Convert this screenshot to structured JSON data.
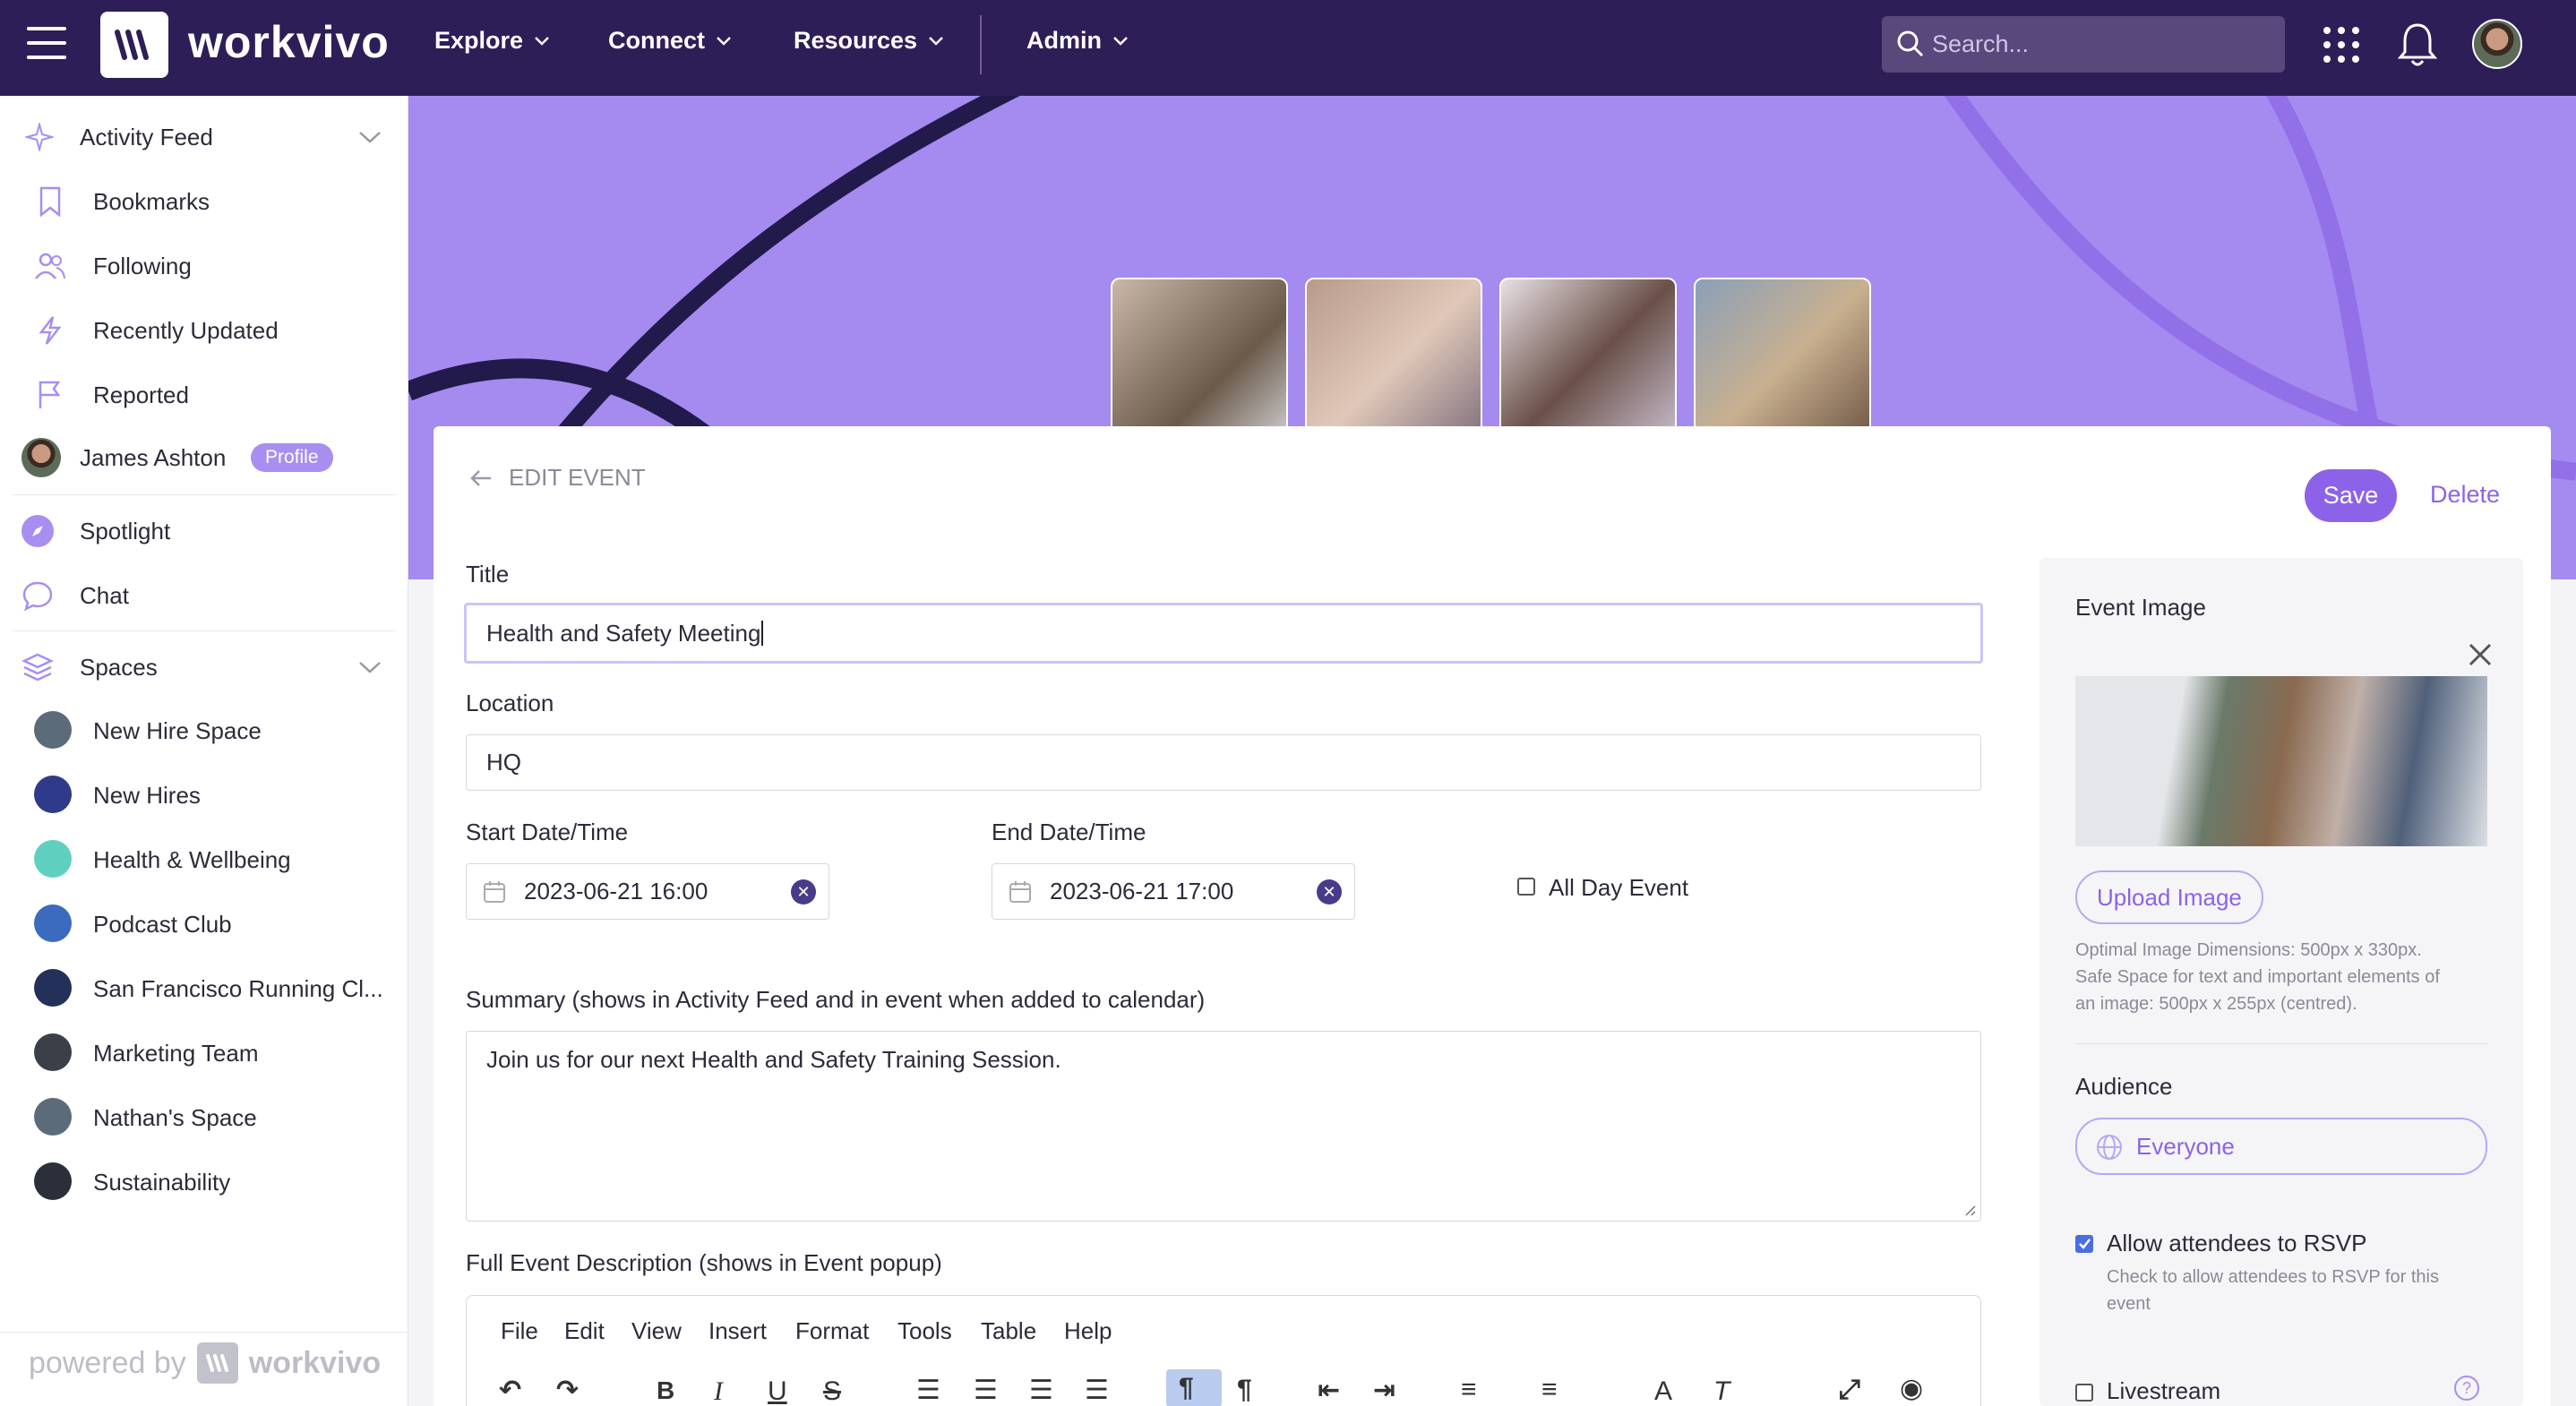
{
  "nav": {
    "brand": "workvivo",
    "items": [
      {
        "label": "Explore"
      },
      {
        "label": "Connect"
      },
      {
        "label": "Resources"
      },
      {
        "label": "Admin"
      }
    ],
    "search_placeholder": "Search..."
  },
  "sidebar": {
    "items": [
      {
        "label": "Activity Feed",
        "icon": "sparkle-icon"
      },
      {
        "label": "Bookmarks",
        "icon": "bookmark-icon"
      },
      {
        "label": "Following",
        "icon": "users-icon"
      },
      {
        "label": "Recently Updated",
        "icon": "lightning-icon"
      },
      {
        "label": "Reported",
        "icon": "flag-icon"
      }
    ],
    "user": {
      "name": "James Ashton",
      "badge": "Profile"
    },
    "extra": [
      {
        "label": "Spotlight",
        "icon": "compass-icon"
      },
      {
        "label": "Chat",
        "icon": "chat-icon"
      }
    ],
    "spaces_label": "Spaces",
    "spaces": [
      {
        "label": "New Hire Space",
        "color": "#5b6b7a"
      },
      {
        "label": "New Hires",
        "color": "#2f3a8a"
      },
      {
        "label": "Health & Wellbeing",
        "color": "#5fd0c0"
      },
      {
        "label": "Podcast Club",
        "color": "#3b6bbf"
      },
      {
        "label": "San Francisco Running Cl...",
        "color": "#22305a"
      },
      {
        "label": "Marketing Team",
        "color": "#3a3f48"
      },
      {
        "label": "Nathan's Space",
        "color": "#5b6b7a"
      },
      {
        "label": "Sustainability",
        "color": "#2a2f3a"
      }
    ],
    "powered_by": "powered by",
    "powered_brand": "workvivo"
  },
  "form": {
    "heading": "EDIT EVENT",
    "save": "Save",
    "delete": "Delete",
    "title_label": "Title",
    "title_value": "Health and Safety Meeting",
    "location_label": "Location",
    "location_value": "HQ",
    "start_label": "Start Date/Time",
    "start_value": "2023-06-21 16:00",
    "end_label": "End Date/Time",
    "end_value": "2023-06-21 17:00",
    "all_day_label": "All Day Event",
    "summary_label": "Summary (shows in Activity Feed and in event when added to calendar)",
    "summary_value": "Join us for our next Health and Safety Training Session.",
    "desc_label": "Full Event Description (shows in Event popup)",
    "menu": [
      "File",
      "Edit",
      "View",
      "Insert",
      "Format",
      "Tools",
      "Table",
      "Help"
    ]
  },
  "panel": {
    "event_image_label": "Event Image",
    "upload_label": "Upload Image",
    "hint1": "Optimal Image Dimensions: 500px x 330px.",
    "hint2": "Safe Space for text and important elements of",
    "hint3": "an image: 500px x 255px (centred).",
    "audience_label": "Audience",
    "audience_value": "Everyone",
    "rsvp_label": "Allow attendees to RSVP",
    "rsvp_hint1": "Check to allow attendees to RSVP for this",
    "rsvp_hint2": "event",
    "livestream_label": "Livestream"
  },
  "colors": {
    "nav_bg": "#2e1e57",
    "banner": "#a58af0",
    "accent": "#8c63e8"
  }
}
